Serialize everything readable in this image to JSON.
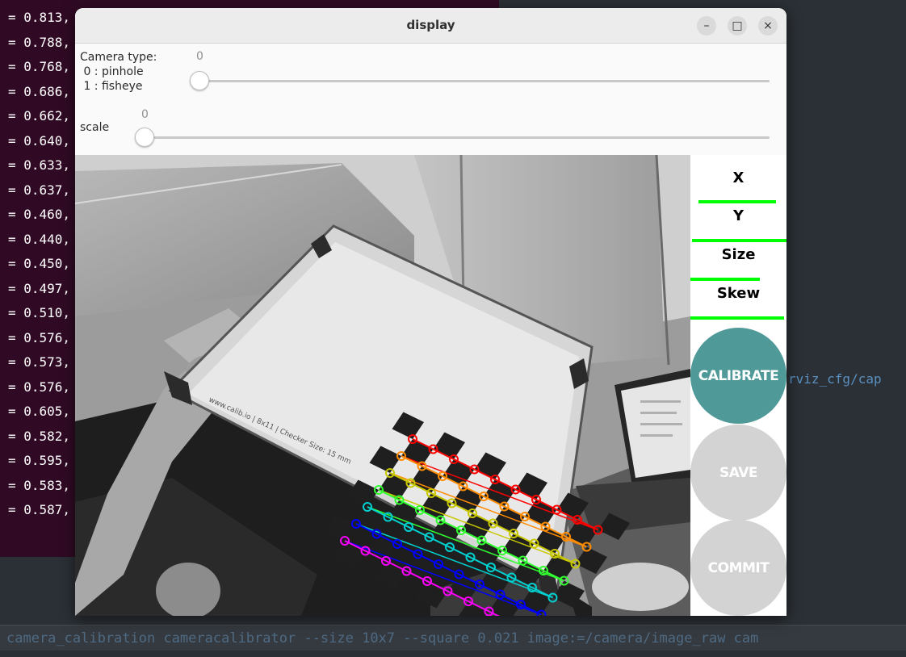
{
  "terminal": {
    "lines": [
      "= 0.813,",
      "= 0.788,",
      "= 0.768,",
      "= 0.686,",
      "= 0.662,",
      "= 0.640,",
      "= 0.633,",
      "= 0.637,",
      "= 0.460,",
      "= 0.440,",
      "= 0.450,",
      "= 0.497,",
      "= 0.510,",
      "= 0.576,",
      "= 0.573,",
      "= 0.576,",
      "= 0.605,",
      "= 0.582,",
      "= 0.595,",
      "= 0.583,",
      "= 0.587,"
    ]
  },
  "editor": {
    "path_fragment": "rviz_cfg/cap"
  },
  "command_line": {
    "text": "camera_calibration cameracalibrator --size 10x7 --square 0.021 image:=/camera/image_raw cam"
  },
  "window": {
    "title": "display",
    "controls": [
      "minimize",
      "maximize",
      "close"
    ],
    "close_glyph": "×",
    "minimize_glyph": "–",
    "maximize_glyph": "□"
  },
  "trackbars": {
    "camera_type": {
      "label": "Camera type:\n 0 : pinhole\n 1 : fisheye",
      "value": "0"
    },
    "scale": {
      "label": "scale",
      "value": "0"
    }
  },
  "calibration": {
    "metrics": [
      {
        "label": "X"
      },
      {
        "label": "Y"
      },
      {
        "label": "Size"
      },
      {
        "label": "Skew"
      }
    ],
    "buttons": {
      "calibrate": {
        "label": "CALIBRATE",
        "color": "#4f9a98",
        "enabled": true
      },
      "save": {
        "label": "SAVE",
        "color": "#d3d3d3",
        "enabled": false
      },
      "commit": {
        "label": "COMMIT",
        "color": "#d3d3d3",
        "enabled": false
      }
    },
    "bar_color": "#00ff00",
    "board_text": "www.calib.io | 8x11 | Checker Size: 15 mm"
  },
  "colors": {
    "terminal_bg": "#300a24",
    "editor_bg": "#2b3036",
    "row_colors": [
      "#ff0000",
      "#ff8c00",
      "#c8c800",
      "#30ff30",
      "#00d0d0",
      "#0000ff",
      "#ff00ff"
    ]
  }
}
